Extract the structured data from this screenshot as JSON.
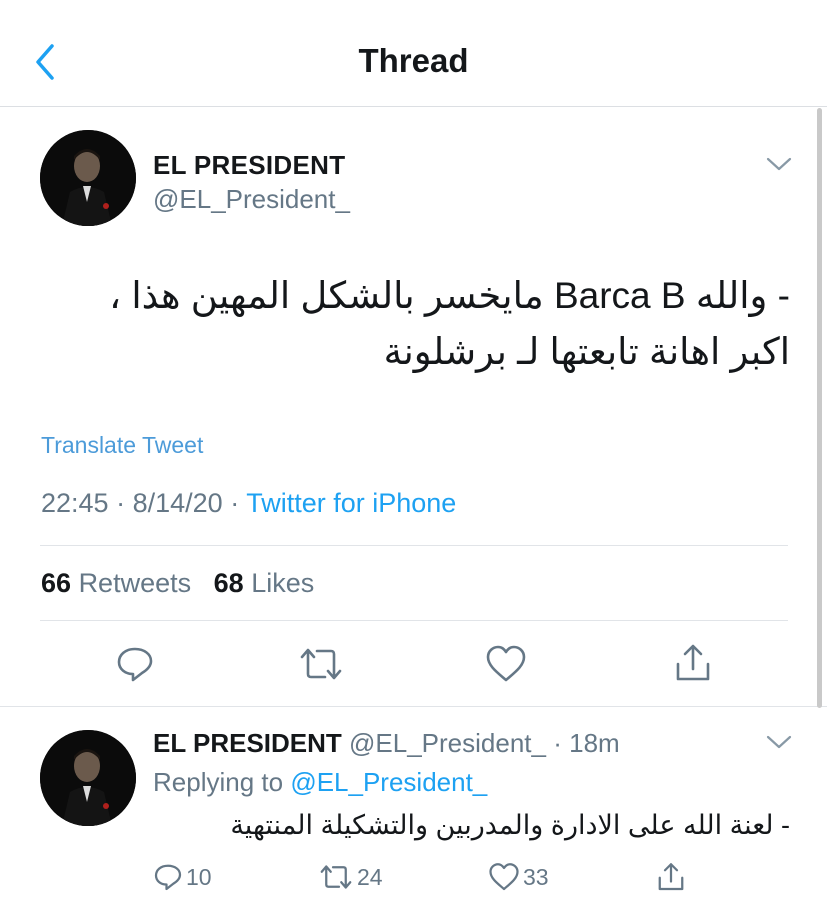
{
  "header": {
    "title": "Thread"
  },
  "tweet": {
    "name": "EL PRESIDENT",
    "handle": "@EL_President_",
    "text": "- والله Barca B مايخسر بالشكل المهين هذا ، اكبر اهانة تابعتها لـ برشلونة",
    "translate_label": "Translate Tweet",
    "time": "22:45",
    "date": "8/14/20",
    "separator": "·",
    "source": "Twitter for iPhone",
    "retweets_count": "66",
    "retweets_label": "Retweets",
    "likes_count": "68",
    "likes_label": "Likes"
  },
  "reply": {
    "name": "EL PRESIDENT",
    "handle": "@EL_President_",
    "separator": "·",
    "time": "18m",
    "replying_prefix": "Replying to",
    "replying_to": "@EL_President_",
    "text": "- لعنة الله على الادارة والمدربين والتشكيلة المنتهية",
    "reply_count": "10",
    "retweet_count": "24",
    "like_count": "33"
  },
  "icons": {
    "back": "chevron-left-icon",
    "caret": "chevron-down-icon",
    "reply": "reply-icon",
    "retweet": "retweet-icon",
    "like": "heart-icon",
    "share": "share-icon"
  },
  "colors": {
    "accent": "#1da1f2",
    "icon": "#657786",
    "text": "#14171a"
  }
}
